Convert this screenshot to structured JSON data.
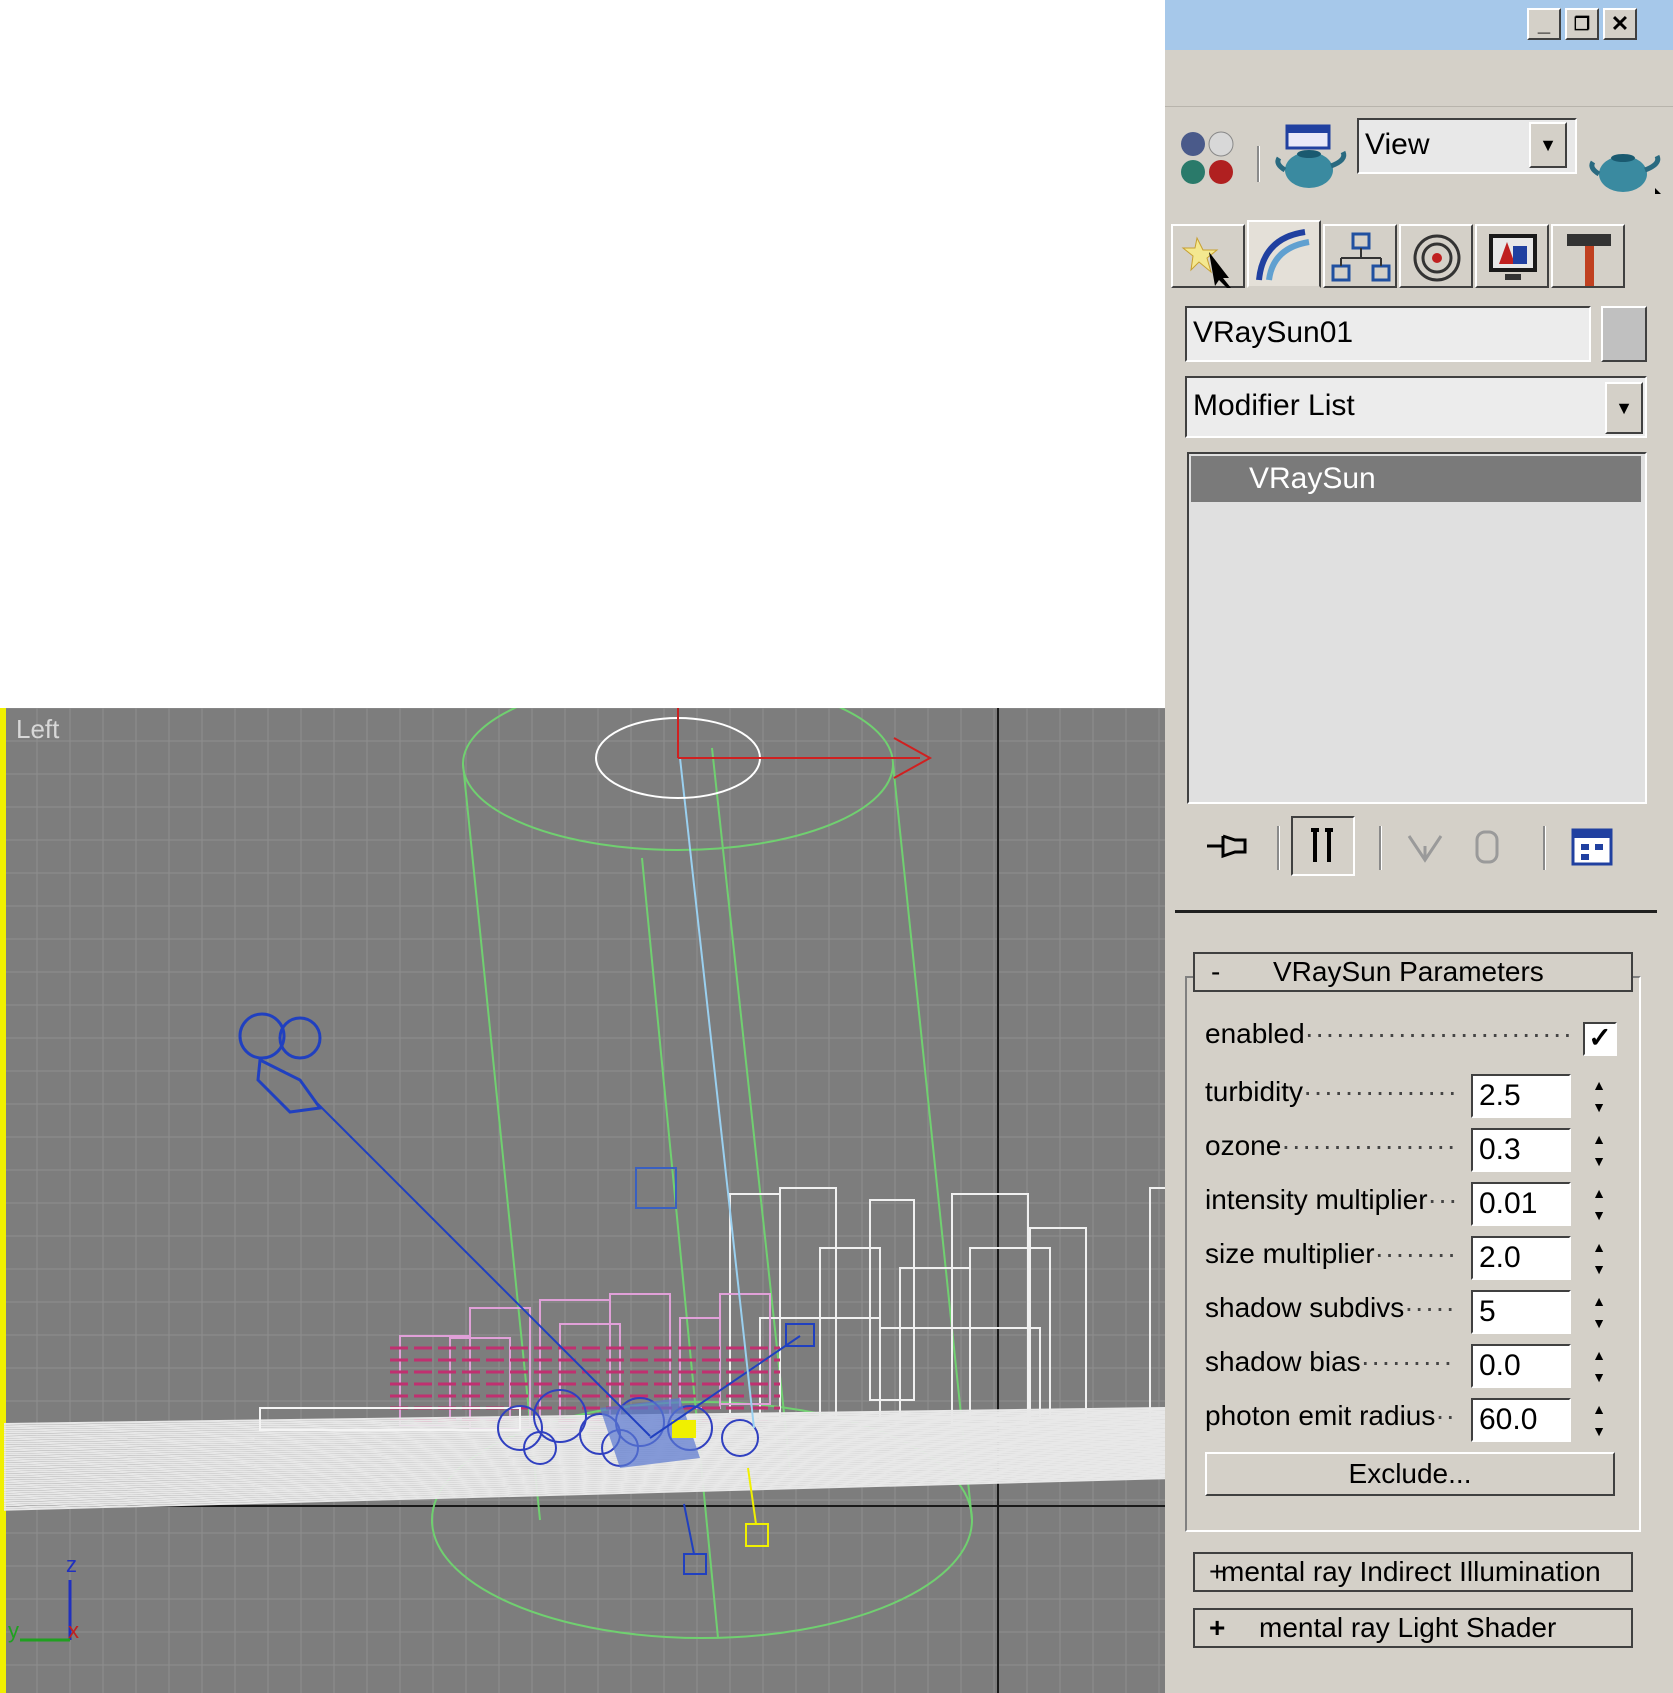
{
  "viewport": {
    "label": "Left",
    "axis": {
      "z": "z",
      "y": "y",
      "x": "x"
    }
  },
  "window_controls": {
    "minimize": "_",
    "restore": "❐",
    "close": "✕"
  },
  "toolbar": {
    "view_dropdown": "View"
  },
  "tabs": [
    "create-tab",
    "modify-tab",
    "hierarchy-tab",
    "motion-tab",
    "display-tab",
    "utilities-tab"
  ],
  "object": {
    "name": "VRaySun01",
    "color": "#c0c0c0"
  },
  "modifier_list": {
    "label": "Modifier List"
  },
  "stack": {
    "items": [
      "VRaySun"
    ]
  },
  "rollouts": {
    "params": {
      "toggle": "-",
      "title": "VRaySun Parameters",
      "enabled_label": "enabled",
      "enabled_checked": "✓",
      "rows": [
        {
          "label": "turbidity",
          "value": "2.5"
        },
        {
          "label": "ozone",
          "value": "0.3"
        },
        {
          "label": "intensity multiplier",
          "value": "0.01"
        },
        {
          "label": "size multiplier",
          "value": "2.0"
        },
        {
          "label": "shadow subdivs",
          "value": "5"
        },
        {
          "label": "shadow bias",
          "value": "0.0"
        },
        {
          "label": "photon emit radius",
          "value": "60.0"
        }
      ],
      "exclude_label": "Exclude..."
    },
    "indirect": {
      "toggle": "+",
      "title": "mental ray Indirect Illumination"
    },
    "shader": {
      "toggle": "+",
      "title": "mental ray Light Shader"
    }
  }
}
